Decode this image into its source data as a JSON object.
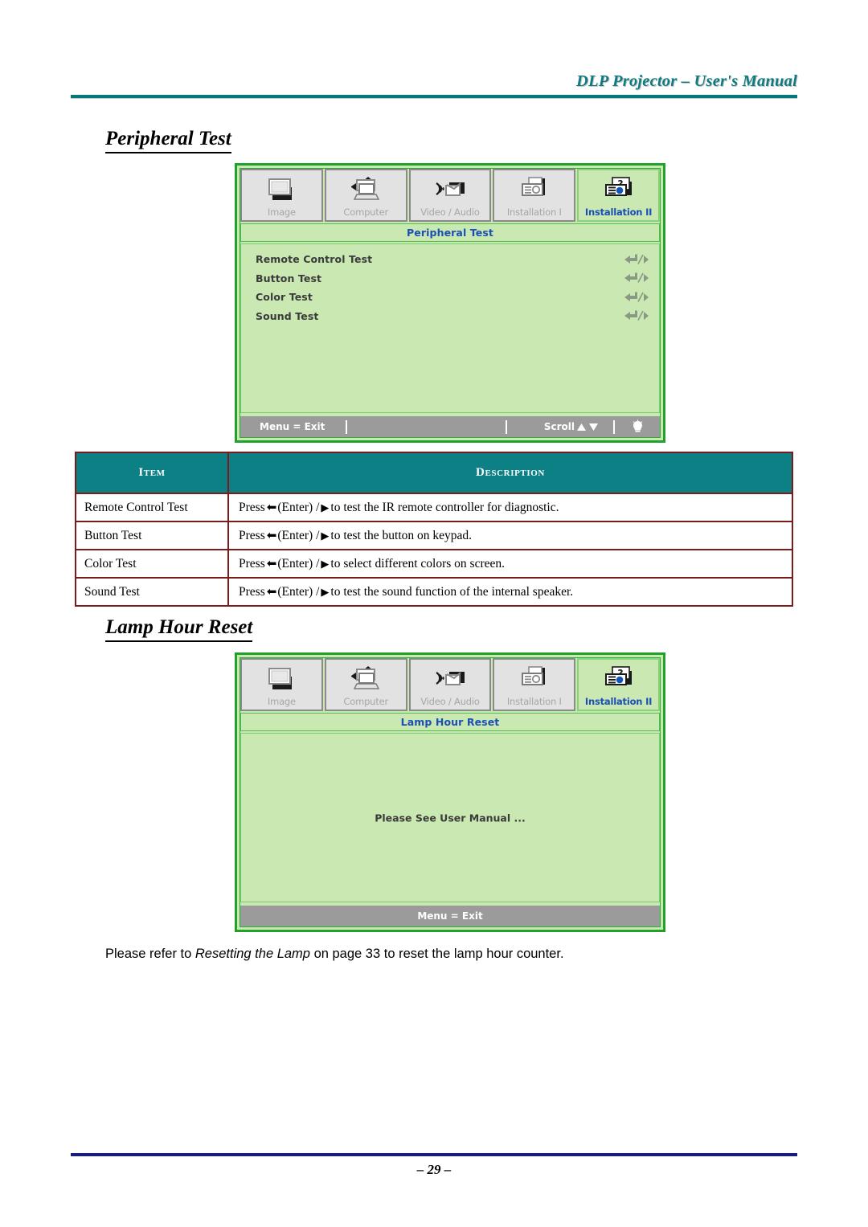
{
  "header": {
    "title": "DLP Projector – User's Manual"
  },
  "sections": {
    "peripheral": {
      "heading": "Peripheral Test"
    },
    "lamp": {
      "heading": "Lamp Hour Reset"
    }
  },
  "osd_peripheral": {
    "tabs": [
      {
        "label": "Image",
        "icon": "image-icon",
        "active": false
      },
      {
        "label": "Computer",
        "icon": "computer-icon",
        "active": false
      },
      {
        "label": "Video / Audio",
        "icon": "video-audio-icon",
        "active": false
      },
      {
        "label": "Installation I",
        "icon": "installation-1-icon",
        "active": false
      },
      {
        "label": "Installation II",
        "icon": "installation-2-icon",
        "active": true
      }
    ],
    "subtitle": "Peripheral Test",
    "rows": [
      {
        "label": "Remote Control Test",
        "control": "enter-slash-right-icon"
      },
      {
        "label": "Button Test",
        "control": "enter-slash-right-icon"
      },
      {
        "label": "Color Test",
        "control": "enter-slash-right-icon"
      },
      {
        "label": "Sound Test",
        "control": "enter-slash-right-icon"
      }
    ],
    "footer": {
      "exit": "Menu = Exit",
      "scroll": "Scroll",
      "scroll_up_icon": "triangle-up-icon",
      "scroll_down_icon": "triangle-down-icon",
      "lamp_icon": "lamp-bulb-icon"
    }
  },
  "osd_lamp": {
    "tabs": [
      {
        "label": "Image",
        "icon": "image-icon",
        "active": false
      },
      {
        "label": "Computer",
        "icon": "computer-icon",
        "active": false
      },
      {
        "label": "Video / Audio",
        "icon": "video-audio-icon",
        "active": false
      },
      {
        "label": "Installation I",
        "icon": "installation-1-icon",
        "active": false
      },
      {
        "label": "Installation II",
        "icon": "installation-2-icon",
        "active": true
      }
    ],
    "subtitle": "Lamp Hour Reset",
    "message": "Please See User Manual ...",
    "footer": {
      "exit": "Menu = Exit"
    }
  },
  "table": {
    "headers": {
      "item": "Item",
      "description": "Description"
    },
    "rows": [
      {
        "item": "Remote Control Test",
        "press": "Press",
        "enter": "(Enter) /",
        "tail": "to test the IR remote controller for diagnostic."
      },
      {
        "item": "Button Test",
        "press": "Press",
        "enter": "(Enter) /",
        "tail": "to test the button on keypad."
      },
      {
        "item": "Color Test",
        "press": "Press",
        "enter": "(Enter) /",
        "tail": "to select different colors on screen."
      },
      {
        "item": "Sound Test",
        "press": "Press",
        "enter": "(Enter) /",
        "tail": "to test the sound function of the internal speaker."
      }
    ]
  },
  "note": {
    "prefix": "Please refer to ",
    "italic": "Resetting the Lamp",
    "suffix": " on page 33 to reset the lamp hour counter."
  },
  "footer": {
    "page_number": "– 29 –"
  },
  "colors": {
    "header_teal": "#03797e",
    "table_header_teal": "#0d8085",
    "table_border_maroon": "#7b1b1b",
    "osd_green_border": "#22a12a",
    "osd_green_fill": "#c9e8b2",
    "osd_bar_gray": "#9b9b9b",
    "active_tab_blue": "#1b4fb5",
    "footer_rule_navy": "#151a8c"
  }
}
